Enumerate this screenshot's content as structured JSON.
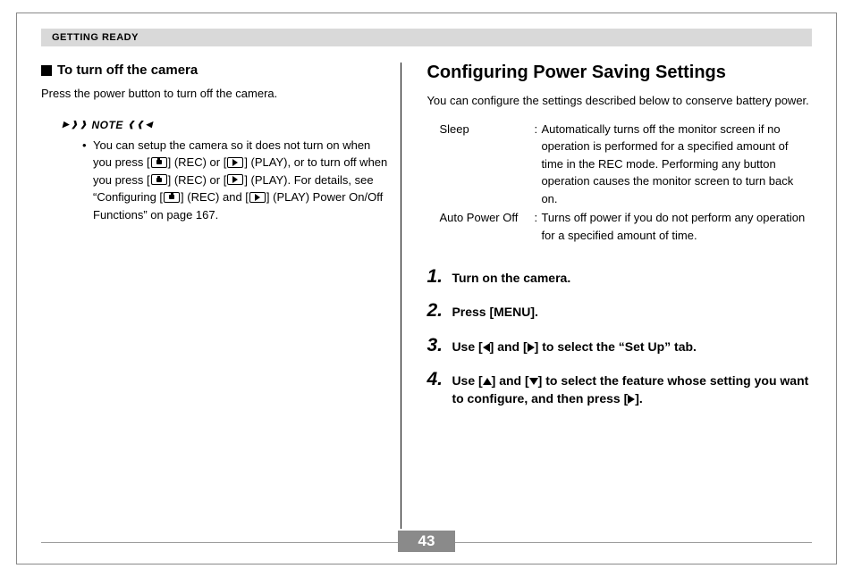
{
  "header": "GETTING READY",
  "left": {
    "heading": "To turn off the camera",
    "body": "Press the power button to turn off the camera.",
    "note_label": "NOTE",
    "note_pre": "You can setup the camera so it does not turn on when you press [",
    "note_mid1": "] (REC) or [",
    "note_mid2": "] (PLAY), or to turn off when you press [",
    "note_mid3": "] (REC) or [",
    "note_mid4": "] (PLAY). For details, see “Configuring [",
    "note_mid5": "] (REC) and [",
    "note_tail": "] (PLAY) Power On/Off Functions” on page 167."
  },
  "right": {
    "heading": "Configuring Power Saving Settings",
    "intro": "You can configure the settings described below to conserve battery power.",
    "defs": [
      {
        "term": "Sleep",
        "desc": "Automatically turns off the monitor screen if no operation is performed for a specified amount of time in the REC mode. Performing any button operation causes the monitor screen to turn back on."
      },
      {
        "term": "Auto Power Off",
        "desc": "Turns off power if you do not perform any operation for a specified amount of time."
      }
    ],
    "steps": {
      "s1": "Turn on the camera.",
      "s2": "Press [MENU].",
      "s3_pre": "Use [",
      "s3_mid": "] and [",
      "s3_post": "] to select the “Set Up” tab.",
      "s4_pre": "Use [",
      "s4_mid": "] and [",
      "s4_mid2": "] to select the feature whose setting you want to configure, and then press [",
      "s4_post": "]."
    }
  },
  "page_number": "43"
}
